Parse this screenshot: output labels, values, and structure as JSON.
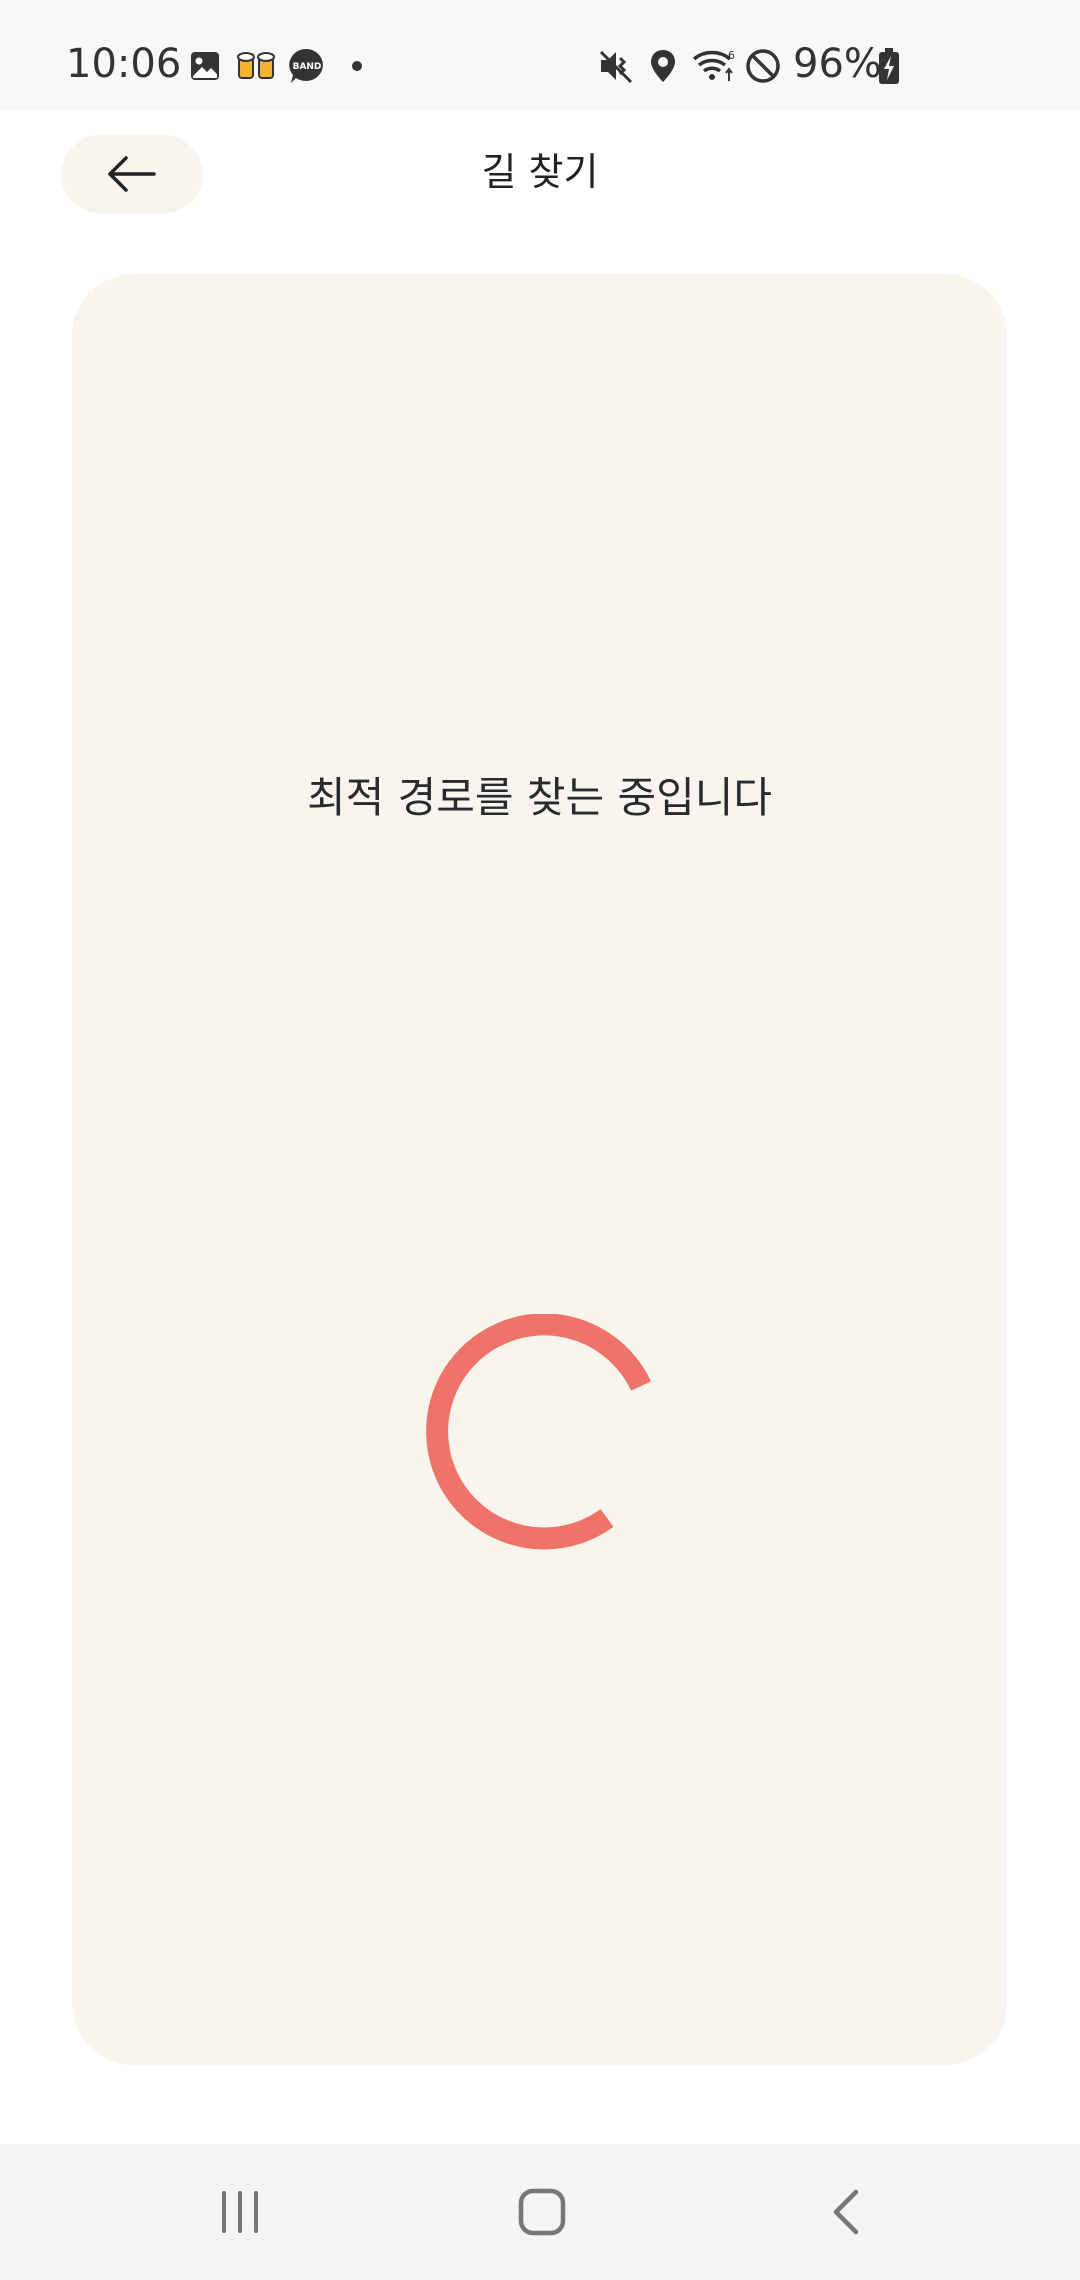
{
  "status_bar": {
    "time": "10:06",
    "battery": "96%",
    "icons": [
      "image-icon",
      "beer-icon",
      "band-icon",
      "dot-icon",
      "mute-icon",
      "location-icon",
      "wifi-icon",
      "block-icon",
      "battery-icon"
    ],
    "band_label": "BAND"
  },
  "header": {
    "title": "길 찾기",
    "back_icon": "arrow-left-icon"
  },
  "main": {
    "message": "최적 경로를 찾는 중입니다",
    "spinner_color": "#ef7368",
    "card_color": "#f7f5ee"
  },
  "nav_bar": {
    "items": [
      "recent-apps-icon",
      "home-icon",
      "back-icon"
    ]
  }
}
